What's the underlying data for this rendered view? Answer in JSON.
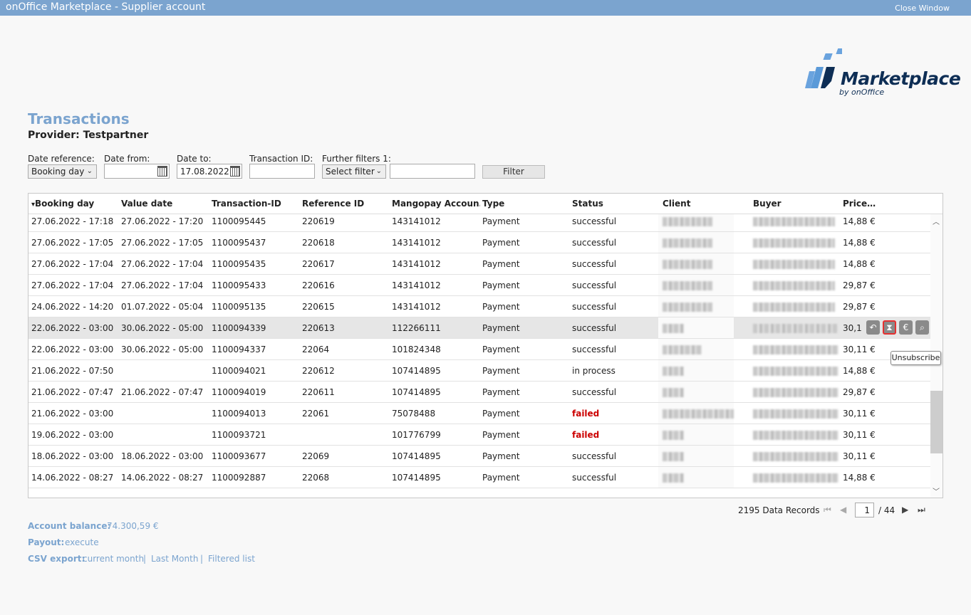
{
  "window": {
    "title": "onOffice Marketplace - Supplier account",
    "close_label": "Close Window"
  },
  "logo": {
    "word": "Marketplace",
    "sub": "by onOffice"
  },
  "page": {
    "title": "Transactions",
    "provider": "Provider: Testpartner"
  },
  "filters": {
    "date_reference_label": "Date reference:",
    "date_reference_value": "Booking day",
    "date_from_label": "Date from:",
    "date_from_value": "",
    "date_to_label": "Date to:",
    "date_to_value": "17.08.2022",
    "transaction_id_label": "Transaction ID:",
    "transaction_id_value": "",
    "further_label": "Further filters 1:",
    "further_value": "Select filter",
    "further_text": "",
    "filter_button": "Filter"
  },
  "table": {
    "sort_indicator": "▾",
    "columns": [
      "Booking day",
      "Value date",
      "Transaction-ID",
      "Reference ID",
      "Mangopay Accoun…",
      "Type",
      "Status",
      "Client",
      "Buyer",
      "Price…"
    ],
    "rows": [
      [
        "27.06.2022 - 17:18",
        "27.06.2022 - 17:20",
        "1100095445",
        "220619",
        "143141012",
        "Payment",
        "successful",
        "14,88 €"
      ],
      [
        "27.06.2022 - 17:05",
        "27.06.2022 - 17:05",
        "1100095437",
        "220618",
        "143141012",
        "Payment",
        "successful",
        "14,88 €"
      ],
      [
        "27.06.2022 - 17:04",
        "27.06.2022 - 17:04",
        "1100095435",
        "220617",
        "143141012",
        "Payment",
        "successful",
        "14,88 €"
      ],
      [
        "27.06.2022 - 17:04",
        "27.06.2022 - 17:04",
        "1100095433",
        "220616",
        "143141012",
        "Payment",
        "successful",
        "29,87 €"
      ],
      [
        "24.06.2022 - 14:20",
        "01.07.2022 - 05:04",
        "1100095135",
        "220615",
        "143141012",
        "Payment",
        "successful",
        "29,87 €"
      ],
      [
        "22.06.2022 - 03:00",
        "30.06.2022 - 05:00",
        "1100094339",
        "220613",
        "112266111",
        "Payment",
        "successful",
        "30,1"
      ],
      [
        "22.06.2022 - 03:00",
        "30.06.2022 - 05:00",
        "1100094337",
        "22064",
        "101824348",
        "Payment",
        "successful",
        "30,11 €"
      ],
      [
        "21.06.2022 - 07:50",
        "",
        "1100094021",
        "220612",
        "107414895",
        "Payment",
        "in process",
        "14,88 €"
      ],
      [
        "21.06.2022 - 07:47",
        "21.06.2022 - 07:47",
        "1100094019",
        "220611",
        "107414895",
        "Payment",
        "successful",
        "29,87 €"
      ],
      [
        "21.06.2022 - 03:00",
        "",
        "1100094013",
        "22061",
        "75078488",
        "Payment",
        "failed",
        "30,11 €"
      ],
      [
        "19.06.2022 - 03:00",
        "",
        "1100093721",
        "",
        "101776799",
        "Payment",
        "failed",
        "30,11 €"
      ],
      [
        "18.06.2022 - 03:00",
        "18.06.2022 - 03:00",
        "1100093677",
        "22069",
        "107414895",
        "Payment",
        "successful",
        "30,11 €"
      ],
      [
        "14.06.2022 - 08:27",
        "14.06.2022 - 08:27",
        "1100092887",
        "22068",
        "107414895",
        "Payment",
        "successful",
        "14,88 €"
      ]
    ],
    "row_actions": [
      "undo-icon",
      "hourglass-icon",
      "euro-icon",
      "magnifier-icon"
    ],
    "tooltip": "Unsubscribe"
  },
  "pagination": {
    "records": "2195 Data Records",
    "page": "1",
    "of": "/ 44"
  },
  "footer": {
    "balance_label": "Account balance:",
    "balance_value": "74.300,59 €",
    "payout_label": "Payout:",
    "payout_link": "execute",
    "csv_label": "CSV export:",
    "csv_links": [
      "current month",
      "Last Month",
      "Filtered list"
    ]
  },
  "colors": {
    "accent": "#7ba4cf",
    "failed": "#cc0000",
    "logo_dark": "#0e2e55"
  }
}
